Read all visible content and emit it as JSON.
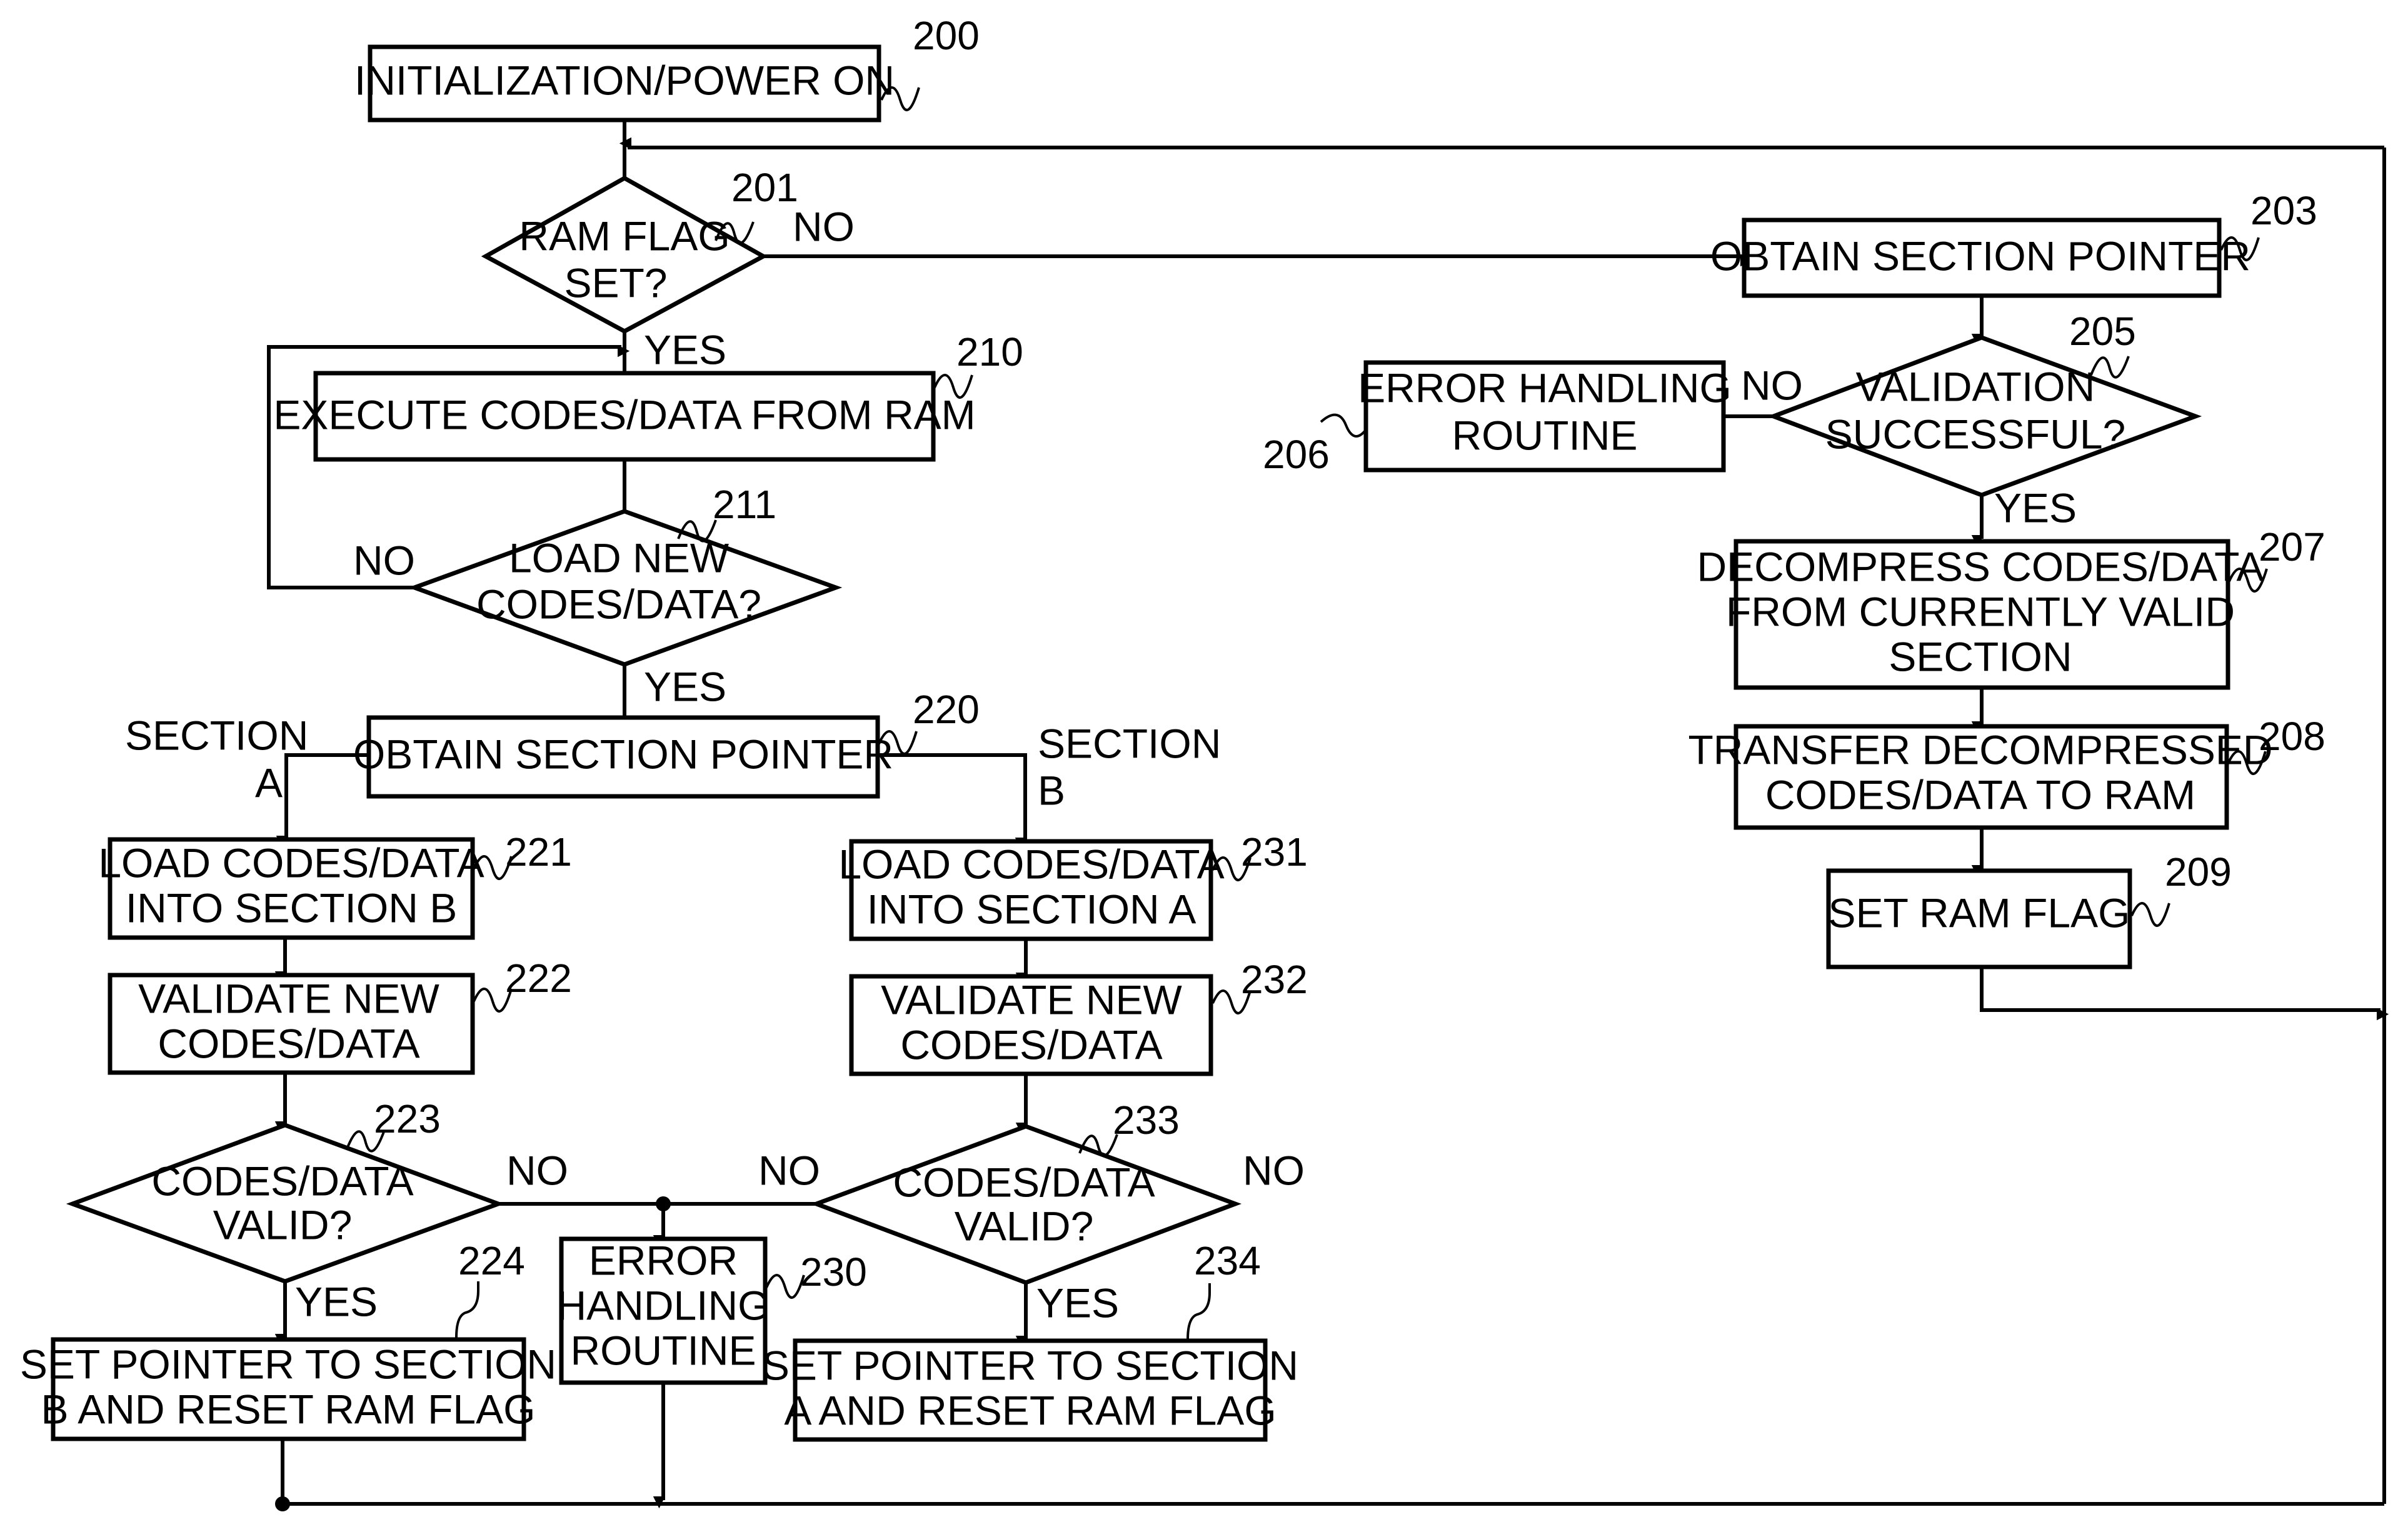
{
  "figure": {
    "nodes": {
      "n200": {
        "ref": "200",
        "lines": [
          "INITIALIZATION/POWER ON"
        ]
      },
      "n201": {
        "ref": "201",
        "lines": [
          "RAM FLAG",
          "SET?"
        ]
      },
      "n203": {
        "ref": "203",
        "lines": [
          "OBTAIN SECTION POINTER"
        ]
      },
      "n205": {
        "ref": "205",
        "lines": [
          "VALIDATION",
          "SUCCESSFUL?"
        ]
      },
      "n206": {
        "ref": "206",
        "lines": [
          "ERROR HANDLING",
          "ROUTINE"
        ]
      },
      "n207": {
        "ref": "207",
        "lines": [
          "DECOMPRESS CODES/DATA",
          "FROM CURRENTLY VALID",
          "SECTION"
        ]
      },
      "n208": {
        "ref": "208",
        "lines": [
          "TRANSFER DECOMPRESSED",
          "CODES/DATA TO RAM"
        ]
      },
      "n209": {
        "ref": "209",
        "lines": [
          "SET RAM FLAG"
        ]
      },
      "n210": {
        "ref": "210",
        "lines": [
          "EXECUTE CODES/DATA FROM RAM"
        ]
      },
      "n211": {
        "ref": "211",
        "lines": [
          "LOAD NEW",
          "CODES/DATA?"
        ]
      },
      "n220": {
        "ref": "220",
        "lines": [
          "OBTAIN SECTION POINTER"
        ]
      },
      "n221": {
        "ref": "221",
        "lines": [
          "LOAD CODES/DATA",
          "INTO SECTION B"
        ]
      },
      "n222": {
        "ref": "222",
        "lines": [
          "VALIDATE NEW",
          "CODES/DATA"
        ]
      },
      "n223": {
        "ref": "223",
        "lines": [
          "CODES/DATA",
          "VALID?"
        ]
      },
      "n224": {
        "ref": "224",
        "lines": [
          "SET POINTER TO SECTION",
          "B AND RESET RAM FLAG"
        ]
      },
      "n230": {
        "ref": "230",
        "lines": [
          "ERROR",
          "HANDLING",
          "ROUTINE"
        ]
      },
      "n231": {
        "ref": "231",
        "lines": [
          "LOAD CODES/DATA",
          "INTO SECTION A"
        ]
      },
      "n232": {
        "ref": "232",
        "lines": [
          "VALIDATE NEW",
          "CODES/DATA"
        ]
      },
      "n233": {
        "ref": "233",
        "lines": [
          "CODES/DATA",
          "VALID?"
        ]
      },
      "n234": {
        "ref": "234",
        "lines": [
          "SET POINTER TO SECTION",
          "A AND RESET RAM FLAG"
        ]
      }
    },
    "edge_labels": {
      "no_201": "NO",
      "yes_201": "YES",
      "no_205": "NO",
      "yes_205": "YES",
      "no_211": "NO",
      "yes_211": "YES",
      "section_a_1": "SECTION",
      "section_a_2": "A",
      "section_b_1": "SECTION",
      "section_b_2": "B",
      "no_223": "NO",
      "yes_223": "YES",
      "no_233_left": "NO",
      "no_233_right": "NO",
      "yes_233": "YES"
    }
  }
}
